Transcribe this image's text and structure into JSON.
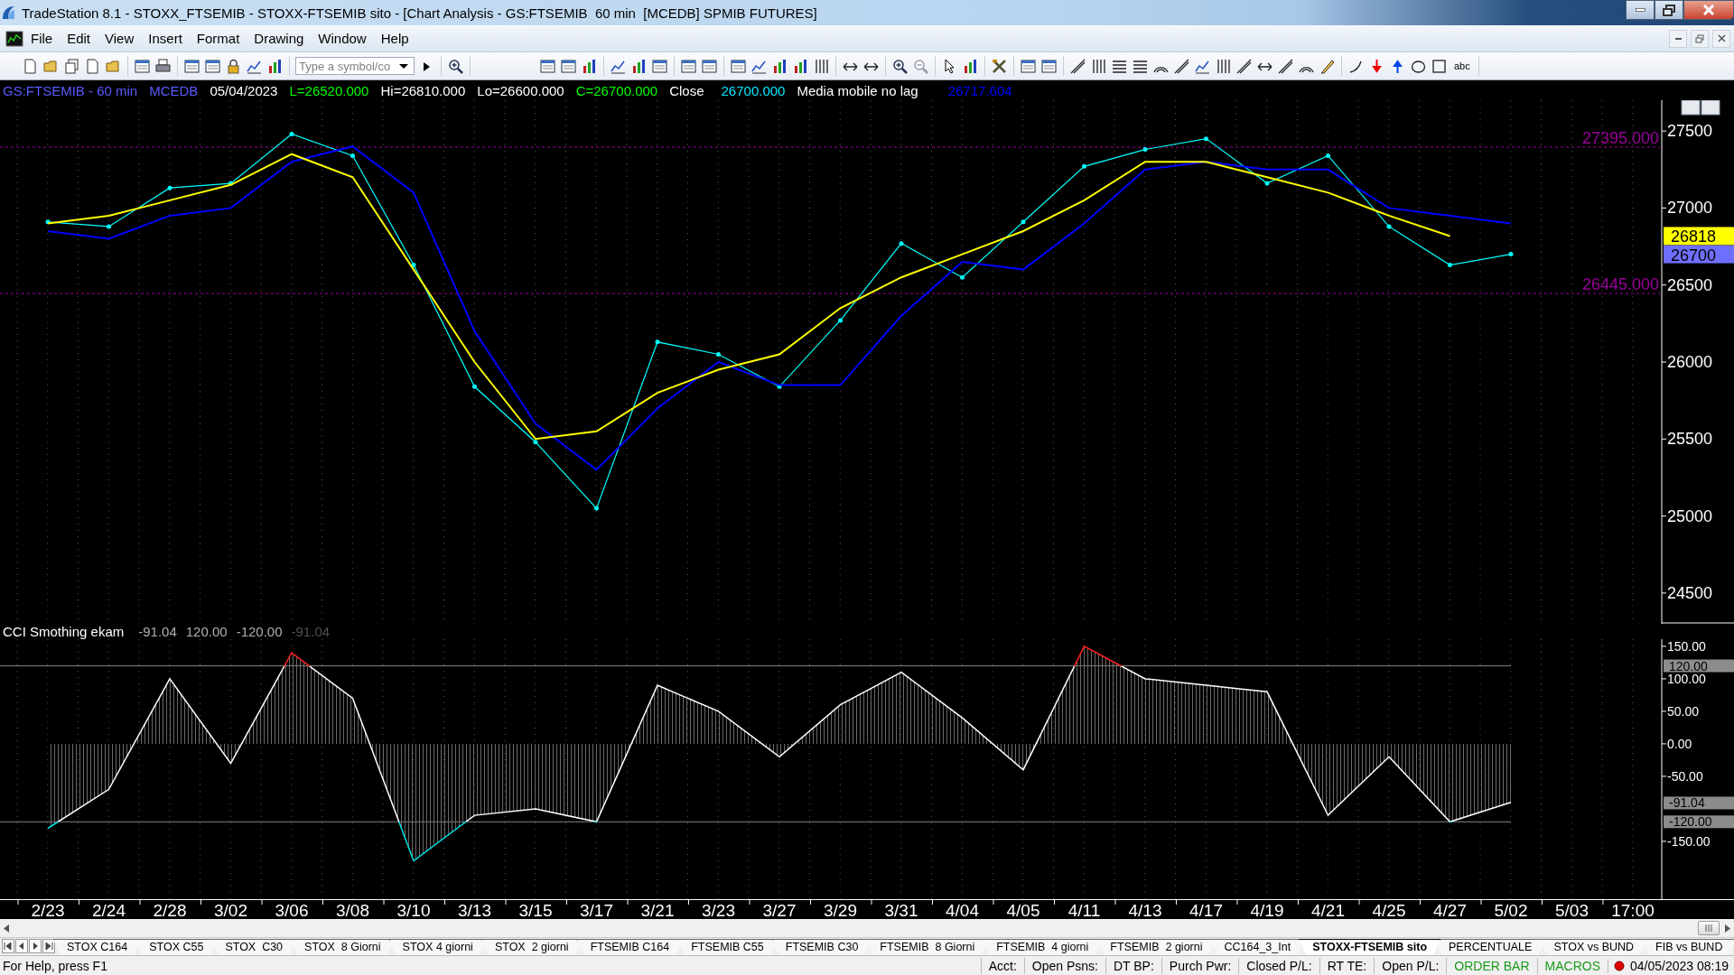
{
  "window": {
    "title": "TradeStation 8.1 - STOXX_FTSEMIB - STOXX-FTSEMIB sito - [Chart Analysis - GS:FTSEMIB  60 min  [MCEDB] SPMIB FUTURES]"
  },
  "menu": [
    "File",
    "Edit",
    "View",
    "Insert",
    "Format",
    "Drawing",
    "Window",
    "Help"
  ],
  "toolbar": {
    "symbol_field": {
      "placeholder": "Type a symbol/co"
    },
    "text_tool": "abc"
  },
  "chart_header": {
    "symbol": "GS:FTSEMIB - 60 min",
    "source": "MCEDB",
    "date": "05/04/2023",
    "last": "L=26520.000",
    "high": "Hi=26810.000",
    "low": "Lo=26600.000",
    "close": "C=26700.000",
    "close_value": "26700.000",
    "indicator_value": "26717.604"
  },
  "price_chart": {
    "chart_data": {
      "type": "line",
      "grid": true,
      "series": [
        {
          "name": "Close",
          "color": "#00ffff",
          "values": [
            26910,
            26880,
            27130,
            27160,
            27480,
            27340,
            26630,
            25840,
            25480,
            25050,
            26130,
            26050,
            25840,
            26270,
            26770,
            26550,
            26910,
            27270,
            27380,
            27450,
            27160,
            27340,
            26880,
            26630,
            26700,
            null,
            null
          ]
        },
        {
          "name": "Media mobile no lag",
          "color": "#0000ff",
          "values": [
            26850,
            26800,
            26950,
            27000,
            27300,
            27400,
            27100,
            26200,
            25600,
            25300,
            25700,
            26000,
            25850,
            25850,
            26300,
            26650,
            26600,
            26900,
            27250,
            27300,
            27250,
            27250,
            27000,
            26950,
            26900,
            null,
            null
          ]
        },
        {
          "color": "#ffff00",
          "values": [
            26900,
            26950,
            27050,
            27150,
            27350,
            27200,
            26600,
            26000,
            25500,
            25550,
            25800,
            25950,
            26050,
            26350,
            26550,
            26700,
            26850,
            27050,
            27300,
            27300,
            27200,
            27100,
            26950,
            26818,
            null,
            null,
            null
          ]
        }
      ],
      "ylim": [
        24300,
        27700
      ],
      "yticks": [
        24500,
        25000,
        25500,
        26000,
        26500,
        27000,
        27500
      ],
      "ref_lines": [
        {
          "axis": "y",
          "value": 27395,
          "label": "27395.000",
          "color": "#990099"
        },
        {
          "axis": "y",
          "value": 26445,
          "label": "26445.000",
          "color": "#990099"
        }
      ]
    },
    "value_markers": [
      {
        "text": "26818",
        "color": "#ffff00"
      },
      {
        "text": "26700",
        "color": "#6f6fff"
      }
    ]
  },
  "cci_header": {
    "values": [
      {
        "text": "-91.04",
        "color": "#b0b0b0"
      },
      {
        "text": "120.00",
        "color": "#b0b0b0"
      },
      {
        "text": "-120.00",
        "color": "#b0b0b0"
      },
      {
        "text": "-91.04",
        "color": "#505050"
      }
    ]
  },
  "cci_chart": {
    "chart_data": {
      "type": "area",
      "grid": true,
      "categories": [
        "2/23",
        "2/24",
        "2/28",
        "3/02",
        "3/06",
        "3/08",
        "3/10",
        "3/13",
        "3/15",
        "3/17",
        "3/21",
        "3/23",
        "3/27",
        "3/29",
        "3/31",
        "4/04",
        "4/05",
        "4/11",
        "4/13",
        "4/17",
        "4/19",
        "4/21",
        "4/25",
        "4/27",
        "5/02",
        "5/03",
        "17:00"
      ],
      "series": [
        {
          "name": "CCI Smothing ekam",
          "color": "#ffffff",
          "values": [
            -130,
            -70,
            100,
            -30,
            140,
            70,
            -180,
            -110,
            -100,
            -120,
            90,
            50,
            -20,
            60,
            110,
            40,
            -40,
            150,
            100,
            90,
            80,
            -110,
            -20,
            -120,
            -90,
            null,
            null
          ]
        }
      ],
      "ylim": [
        -239,
        161
      ],
      "yticks": [
        {
          "value": 150,
          "label": "150.00"
        },
        {
          "value": 100,
          "label": "100.00"
        },
        {
          "value": 50,
          "label": "50.00"
        },
        {
          "value": 0,
          "label": "0.00"
        },
        {
          "value": -50,
          "label": "-50.00"
        },
        {
          "value": -150,
          "label": "-150.00"
        }
      ],
      "ref_lines": [
        {
          "axis": "y",
          "value": 120,
          "color": "#808080"
        },
        {
          "axis": "y",
          "value": -120,
          "color": "#808080"
        }
      ]
    },
    "value_markers": [
      {
        "text": "120.00"
      },
      {
        "text": "-91.04"
      },
      {
        "text": "-120.00"
      }
    ]
  },
  "sheet_tabs": [
    {
      "label": "STOX C164",
      "selected": false
    },
    {
      "label": "STOX C55",
      "selected": false
    },
    {
      "label": "STOX  C30",
      "selected": false
    },
    {
      "label": "STOX  8 Giorni",
      "selected": false
    },
    {
      "label": "STOX 4 giorni",
      "selected": false
    },
    {
      "label": "STOX  2 giorni",
      "selected": false
    },
    {
      "label": "FTSEMIB C164",
      "selected": false
    },
    {
      "label": "FTSEMIB C55",
      "selected": false
    },
    {
      "label": "FTSEMIB C30",
      "selected": false
    },
    {
      "label": "FTSEMIB  8 Giorni",
      "selected": false
    },
    {
      "label": "FTSEMIB  4 giorni",
      "selected": false
    },
    {
      "label": "FTSEMIB  2 giorni",
      "selected": false
    },
    {
      "label": "CC164_3_Int",
      "selected": false
    },
    {
      "label": "STOXX-FTSEMIB sito",
      "selected": true
    },
    {
      "label": "PERCENTUALE",
      "selected": false
    },
    {
      "label": "STOX vs BUND",
      "selected": false
    },
    {
      "label": "FIB vs BUND",
      "selected": false
    }
  ],
  "status_bar": {
    "help": "For Help, press F1",
    "fields": [
      "Acct:",
      "Open Psns:",
      "DT BP:",
      "Purch Pwr:",
      "Closed P/L:",
      "RT TE:",
      "Open P/L:"
    ],
    "order_bar": "ORDER BAR",
    "macros": "MACROS",
    "datetime": "04/05/2023 08:19"
  }
}
